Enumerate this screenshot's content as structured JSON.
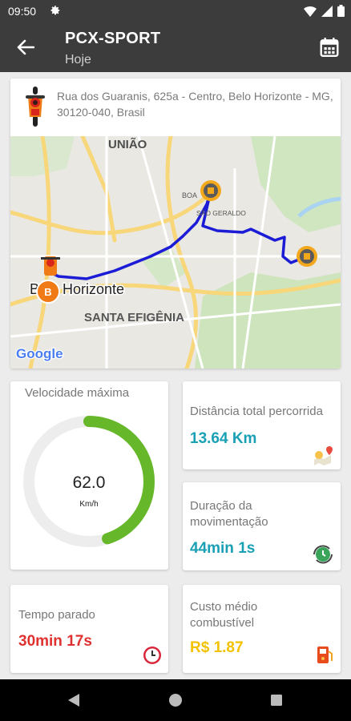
{
  "status": {
    "time": "09:50"
  },
  "appbar": {
    "title": "PCX-SPORT",
    "subtitle": "Hoje"
  },
  "trip": {
    "address": "Rua dos Guaranis, 625a - Centro, Belo Horizonte - MG, 30120-040, Brasil"
  },
  "map": {
    "labels": {
      "uniao": "UNIÃO",
      "boa": "BOA",
      "sao_geraldo": "SÃO GERALDO",
      "city": "Belo Horizonte",
      "santa_efigenia": "SANTA EFIGÊNIA",
      "google": "Google"
    },
    "marker_b": "B"
  },
  "stats": {
    "max_speed": {
      "label": "Velocidade máxima",
      "value": "62.0",
      "unit": "Km/h",
      "gauge_fraction": 0.45,
      "color": "#66b82a"
    },
    "distance": {
      "label": "Distância total percorrida",
      "value": "13.64 Km",
      "color": "#1aa0b5"
    },
    "duration": {
      "label": "Duração da movimentação",
      "value": "44min 1s",
      "color": "#1aa0b5"
    },
    "stopped": {
      "label": "Tempo parado",
      "value": "30min 17s",
      "color": "#e03131"
    },
    "fuel": {
      "label": "Custo médio combustível",
      "value": "R$ 1.87",
      "color": "#f2c200"
    }
  }
}
